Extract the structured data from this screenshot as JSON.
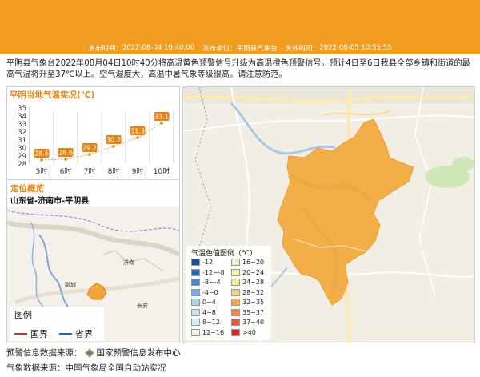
{
  "meta": {
    "publish_time_label": "发布时间：",
    "publish_time": "2022-08-04 10:40:00",
    "publisher_label": "发布单位：",
    "publisher": "平阴县气象台",
    "expire_label": "失效时间：",
    "expire_time": "2022-08-05 10:55:55"
  },
  "description": "平阴县气象台2022年08月04日10时40分将高温黄色预警信号升级为高温橙色预警信号。预计4日至6日我县全部乡镇和街道的最高气温将升至37℃以上。空气湿度大，高温中暑气象等级很高。请注意防范。",
  "temp_panel": {
    "title": "平阴当地气温实况(℃)"
  },
  "chart_data": {
    "type": "line",
    "title": "平阴当地气温实况(℃)",
    "categories": [
      "5时",
      "6时",
      "7时",
      "8时",
      "9时",
      "10时"
    ],
    "values": [
      28.5,
      28.6,
      29.2,
      30.2,
      31.3,
      33.1
    ],
    "ylim": [
      28,
      35
    ],
    "yticks": [
      "35",
      "34",
      "33",
      "32",
      "31",
      "30",
      "29",
      "28"
    ],
    "ylabel": "",
    "xlabel": "",
    "grid": false,
    "colors": {
      "line": "#f3a15d",
      "label_bg": "#e8830f",
      "label_text": "#ffffff"
    }
  },
  "location": {
    "title": "定位概览",
    "region": "山东省-济南市-平阴县",
    "city_labels": [
      "济南",
      "聊城",
      "泰安"
    ],
    "legend_title": "图例",
    "legend_items": [
      "国界",
      "省界"
    ]
  },
  "color_legend": {
    "title": "气温色值图例（℃）",
    "items": [
      {
        "label": "-12",
        "color": "#1f4e9e"
      },
      {
        "label": "16~20",
        "color": "#e5f2c5"
      },
      {
        "label": "-12~-8",
        "color": "#2c66b8"
      },
      {
        "label": "20~24",
        "color": "#f4f3a9"
      },
      {
        "label": "-8~-4",
        "color": "#4c86cf"
      },
      {
        "label": "24~28",
        "color": "#f7e68a"
      },
      {
        "label": "-4~0",
        "color": "#7eaee4"
      },
      {
        "label": "28~32",
        "color": "#f6d48a"
      },
      {
        "label": "0~4",
        "color": "#a9d6f0"
      },
      {
        "label": "32~35",
        "color": "#f5a94a"
      },
      {
        "label": "4~8",
        "color": "#c7e6f2"
      },
      {
        "label": "35~37",
        "color": "#f08a4b"
      },
      {
        "label": "8~12",
        "color": "#d9eef0"
      },
      {
        "label": "37~40",
        "color": "#ea5a2c"
      },
      {
        "label": "12~16",
        "color": "#e9f5dd"
      },
      {
        "label": ">40",
        "color": "#d7262b"
      }
    ]
  },
  "footer": {
    "warning_source_label": "预警信息数据来源：",
    "warning_source": "国家预警信息发布中心",
    "weather_source": "气象数据来源：中国气象局全国自动站实况"
  }
}
